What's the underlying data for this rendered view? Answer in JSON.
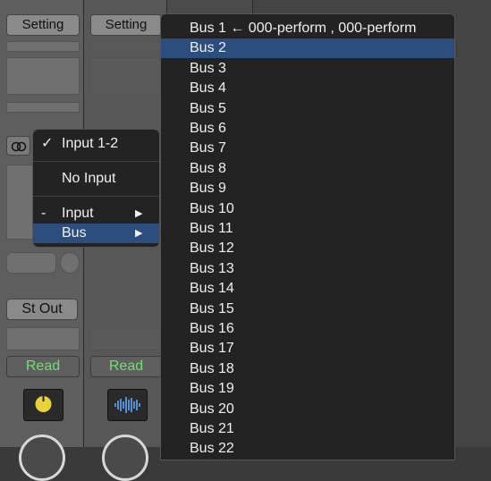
{
  "mixer": {
    "strip1": {
      "setting_label": "Setting",
      "output_label": "St Out",
      "automation_label": "Read"
    },
    "strip2": {
      "setting_label": "Setting",
      "automation_label": "Read"
    }
  },
  "input_menu": {
    "items": [
      {
        "label": "Input 1-2",
        "checked": true
      },
      {
        "label": "No Input"
      },
      {
        "label": "Input",
        "prefix": "-",
        "submenu": true
      },
      {
        "label": "Bus",
        "submenu": true,
        "highlighted": true
      }
    ],
    "check_glyph": "✓",
    "arrow_glyph": "▶"
  },
  "bus_menu": {
    "items": [
      "Bus 1 ← 000-perform , 000-perform",
      "Bus 2",
      "Bus 3",
      "Bus 4",
      "Bus 5",
      "Bus 6",
      "Bus 7",
      "Bus 8",
      "Bus 9",
      "Bus 10",
      "Bus 11",
      "Bus 12",
      "Bus 13",
      "Bus 14",
      "Bus 15",
      "Bus 16",
      "Bus 17",
      "Bus 18",
      "Bus 19",
      "Bus 20",
      "Bus 21",
      "Bus 22"
    ],
    "highlighted_index": 1
  },
  "colors": {
    "highlight": "#2b4e7e",
    "read": "#6fe06f",
    "menu_bg": "#232323"
  },
  "icons": [
    "link-icon",
    "tuner-icon",
    "waveform-icon",
    "checkmark-icon",
    "submenu-arrow-icon"
  ]
}
